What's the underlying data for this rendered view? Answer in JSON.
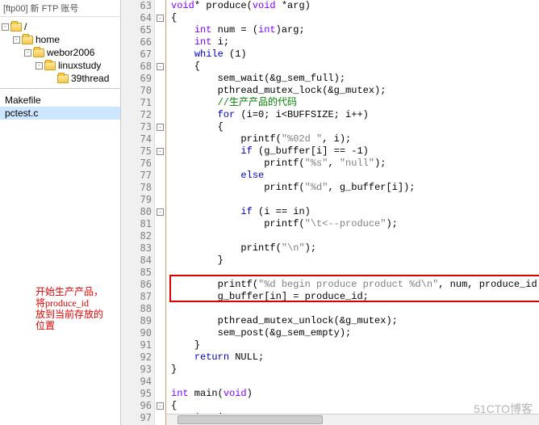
{
  "title_bar": "[ftp00] 新 FTP 账号",
  "tree": {
    "items": [
      {
        "indent": 0,
        "expander": "-",
        "label": "/"
      },
      {
        "indent": 1,
        "expander": "-",
        "label": "home"
      },
      {
        "indent": 2,
        "expander": "-",
        "label": "webor2006"
      },
      {
        "indent": 3,
        "expander": "-",
        "label": "linuxstudy"
      },
      {
        "indent": 4,
        "expander": "",
        "label": "39thread"
      }
    ]
  },
  "files": {
    "items": [
      {
        "label": "Makefile",
        "selected": false
      },
      {
        "label": "pctest.c",
        "selected": true
      }
    ]
  },
  "annotation": {
    "l1": "开始生产产品，",
    "l2": "将produce_id",
    "l3": "放到当前存放的",
    "l4": "位置"
  },
  "watermark": "  51CTO博客",
  "code": {
    "lines": [
      {
        "n": "63",
        "fm": "",
        "tokens": [
          [
            "ty",
            "void"
          ],
          [
            "",
            "* produce("
          ],
          [
            "ty",
            "void"
          ],
          [
            "",
            " *arg)"
          ]
        ]
      },
      {
        "n": "64",
        "fm": "-",
        "tokens": [
          [
            "",
            "{"
          ]
        ]
      },
      {
        "n": "65",
        "fm": "",
        "tokens": [
          [
            "",
            "    "
          ],
          [
            "ty",
            "int"
          ],
          [
            "",
            " num = ("
          ],
          [
            "ty",
            "int"
          ],
          [
            "",
            ")arg;"
          ]
        ]
      },
      {
        "n": "66",
        "fm": "",
        "tokens": [
          [
            "",
            "    "
          ],
          [
            "ty",
            "int"
          ],
          [
            "",
            " i;"
          ]
        ]
      },
      {
        "n": "67",
        "fm": "",
        "tokens": [
          [
            "",
            "    "
          ],
          [
            "kw",
            "while"
          ],
          [
            "",
            " (1)"
          ]
        ]
      },
      {
        "n": "68",
        "fm": "-",
        "tokens": [
          [
            "",
            "    {"
          ]
        ]
      },
      {
        "n": "69",
        "fm": "",
        "tokens": [
          [
            "",
            "        sem_wait(&g_sem_full);"
          ]
        ]
      },
      {
        "n": "70",
        "fm": "",
        "tokens": [
          [
            "",
            "        pthread_mutex_lock(&g_mutex);"
          ]
        ]
      },
      {
        "n": "71",
        "fm": "",
        "tokens": [
          [
            "",
            "        "
          ],
          [
            "cmt",
            "//生产产品的代码"
          ]
        ]
      },
      {
        "n": "72",
        "fm": "",
        "tokens": [
          [
            "",
            "        "
          ],
          [
            "kw",
            "for"
          ],
          [
            "",
            " (i=0; i<BUFFSIZE; i++)"
          ]
        ]
      },
      {
        "n": "73",
        "fm": "-",
        "tokens": [
          [
            "",
            "        {"
          ]
        ]
      },
      {
        "n": "74",
        "fm": "",
        "tokens": [
          [
            "",
            "            printf("
          ],
          [
            "str",
            "\"%02d \""
          ],
          [
            "",
            ", i);"
          ]
        ]
      },
      {
        "n": "75",
        "fm": "-",
        "tokens": [
          [
            "",
            "            "
          ],
          [
            "kw",
            "if"
          ],
          [
            "",
            " (g_buffer[i] == -1)"
          ]
        ]
      },
      {
        "n": "76",
        "fm": "",
        "tokens": [
          [
            "",
            "                printf("
          ],
          [
            "str",
            "\"%s\""
          ],
          [
            "",
            ", "
          ],
          [
            "str",
            "\"null\""
          ],
          [
            "",
            ");"
          ]
        ]
      },
      {
        "n": "77",
        "fm": "",
        "tokens": [
          [
            "",
            "            "
          ],
          [
            "kw",
            "else"
          ]
        ]
      },
      {
        "n": "78",
        "fm": "",
        "tokens": [
          [
            "",
            "                printf("
          ],
          [
            "str",
            "\"%d\""
          ],
          [
            "",
            ", g_buffer[i]);"
          ]
        ]
      },
      {
        "n": "79",
        "fm": "",
        "tokens": [
          [
            "",
            ""
          ]
        ]
      },
      {
        "n": "80",
        "fm": "-",
        "tokens": [
          [
            "",
            "            "
          ],
          [
            "kw",
            "if"
          ],
          [
            "",
            " (i == in)"
          ]
        ]
      },
      {
        "n": "81",
        "fm": "",
        "tokens": [
          [
            "",
            "                printf("
          ],
          [
            "str",
            "\"\\t<--produce\""
          ],
          [
            "",
            ");"
          ]
        ]
      },
      {
        "n": "82",
        "fm": "",
        "tokens": [
          [
            "",
            ""
          ]
        ]
      },
      {
        "n": "83",
        "fm": "",
        "tokens": [
          [
            "",
            "            printf("
          ],
          [
            "str",
            "\"\\n\""
          ],
          [
            "",
            ");"
          ]
        ]
      },
      {
        "n": "84",
        "fm": "",
        "tokens": [
          [
            "",
            "        }"
          ]
        ]
      },
      {
        "n": "85",
        "fm": "",
        "tokens": [
          [
            "",
            ""
          ]
        ]
      },
      {
        "n": "86",
        "fm": "",
        "tokens": [
          [
            "",
            "        printf("
          ],
          [
            "str",
            "\"%d begin produce product %d\\n\""
          ],
          [
            "",
            ", num, produce_id);"
          ]
        ]
      },
      {
        "n": "87",
        "fm": "",
        "tokens": [
          [
            "",
            "        g_buffer[in] = produce_id;"
          ]
        ]
      },
      {
        "n": "88",
        "fm": "",
        "tokens": [
          [
            "",
            ""
          ]
        ]
      },
      {
        "n": "89",
        "fm": "",
        "tokens": [
          [
            "",
            "        pthread_mutex_unlock(&g_mutex);"
          ]
        ]
      },
      {
        "n": "90",
        "fm": "",
        "tokens": [
          [
            "",
            "        sem_post(&g_sem_empty);"
          ]
        ]
      },
      {
        "n": "91",
        "fm": "",
        "tokens": [
          [
            "",
            "    }"
          ]
        ]
      },
      {
        "n": "92",
        "fm": "",
        "tokens": [
          [
            "",
            "    "
          ],
          [
            "kw",
            "return"
          ],
          [
            "",
            " NULL;"
          ]
        ]
      },
      {
        "n": "93",
        "fm": "",
        "tokens": [
          [
            "",
            "}"
          ]
        ]
      },
      {
        "n": "94",
        "fm": "",
        "tokens": [
          [
            "",
            ""
          ]
        ]
      },
      {
        "n": "95",
        "fm": "",
        "tokens": [
          [
            "ty",
            "int"
          ],
          [
            "",
            " main("
          ],
          [
            "ty",
            "void"
          ],
          [
            "",
            ")"
          ]
        ]
      },
      {
        "n": "96",
        "fm": "-",
        "tokens": [
          [
            "",
            "{"
          ]
        ]
      },
      {
        "n": "97",
        "fm": "",
        "tokens": [
          [
            "",
            "    "
          ],
          [
            "ty",
            "int"
          ],
          [
            "",
            " i;"
          ]
        ]
      }
    ]
  }
}
